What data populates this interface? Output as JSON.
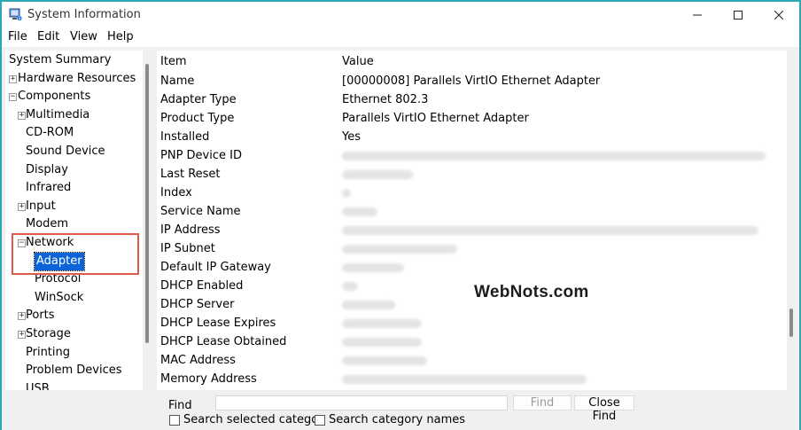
{
  "window": {
    "title": "System Information",
    "accent": "#2aa9b5"
  },
  "menu": [
    "File",
    "Edit",
    "View",
    "Help"
  ],
  "tree": [
    {
      "label": "System Summary",
      "expander": "",
      "level": 0
    },
    {
      "label": "Hardware Resources",
      "expander": "+",
      "level": 0
    },
    {
      "label": "Components",
      "expander": "−",
      "level": 0
    },
    {
      "label": "Multimedia",
      "expander": "+",
      "level": 1
    },
    {
      "label": "CD-ROM",
      "expander": "",
      "level": 1
    },
    {
      "label": "Sound Device",
      "expander": "",
      "level": 1
    },
    {
      "label": "Display",
      "expander": "",
      "level": 1
    },
    {
      "label": "Infrared",
      "expander": "",
      "level": 1
    },
    {
      "label": "Input",
      "expander": "+",
      "level": 1
    },
    {
      "label": "Modem",
      "expander": "",
      "level": 1
    },
    {
      "label": "Network",
      "expander": "−",
      "level": 1
    },
    {
      "label": "Adapter",
      "expander": "",
      "level": 2,
      "selected": true
    },
    {
      "label": "Protocol",
      "expander": "",
      "level": 2
    },
    {
      "label": "WinSock",
      "expander": "",
      "level": 2
    },
    {
      "label": "Ports",
      "expander": "+",
      "level": 1
    },
    {
      "label": "Storage",
      "expander": "+",
      "level": 1
    },
    {
      "label": "Printing",
      "expander": "",
      "level": 1
    },
    {
      "label": "Problem Devices",
      "expander": "",
      "level": 1
    },
    {
      "label": "USB",
      "expander": "",
      "level": 1
    }
  ],
  "details": {
    "header": {
      "item": "Item",
      "value": "Value"
    },
    "rows": [
      {
        "item": "Name",
        "value": "[00000008] Parallels VirtIO Ethernet Adapter"
      },
      {
        "item": "Adapter Type",
        "value": "Ethernet 802.3"
      },
      {
        "item": "Product Type",
        "value": "Parallels VirtIO Ethernet Adapter"
      },
      {
        "item": "Installed",
        "value": "Yes"
      },
      {
        "item": "PNP Device ID",
        "value": "",
        "blurred": true
      },
      {
        "item": "Last Reset",
        "value": "",
        "blurred": true
      },
      {
        "item": "Index",
        "value": "",
        "blurred": true
      },
      {
        "item": "Service Name",
        "value": "",
        "blurred": true
      },
      {
        "item": "IP Address",
        "value": "",
        "blurred": true
      },
      {
        "item": "IP Subnet",
        "value": "",
        "blurred": true
      },
      {
        "item": "Default IP Gateway",
        "value": "",
        "blurred": true
      },
      {
        "item": "DHCP Enabled",
        "value": "",
        "blurred": true
      },
      {
        "item": "DHCP Server",
        "value": "",
        "blurred": true
      },
      {
        "item": "DHCP Lease Expires",
        "value": "",
        "blurred": true
      },
      {
        "item": "DHCP Lease Obtained",
        "value": "",
        "blurred": true
      },
      {
        "item": "MAC Address",
        "value": "",
        "blurred": true
      },
      {
        "item": "Memory Address",
        "value": "",
        "blurred": true
      },
      {
        "item": "",
        "value": "",
        "blurred": true
      }
    ]
  },
  "find": {
    "label": "Find",
    "input_value": "",
    "find_button": "Find",
    "close_button": "Close Find",
    "check_selected": "Search selected categor",
    "check_names": "Search category names"
  },
  "watermark": "WebNots.com"
}
